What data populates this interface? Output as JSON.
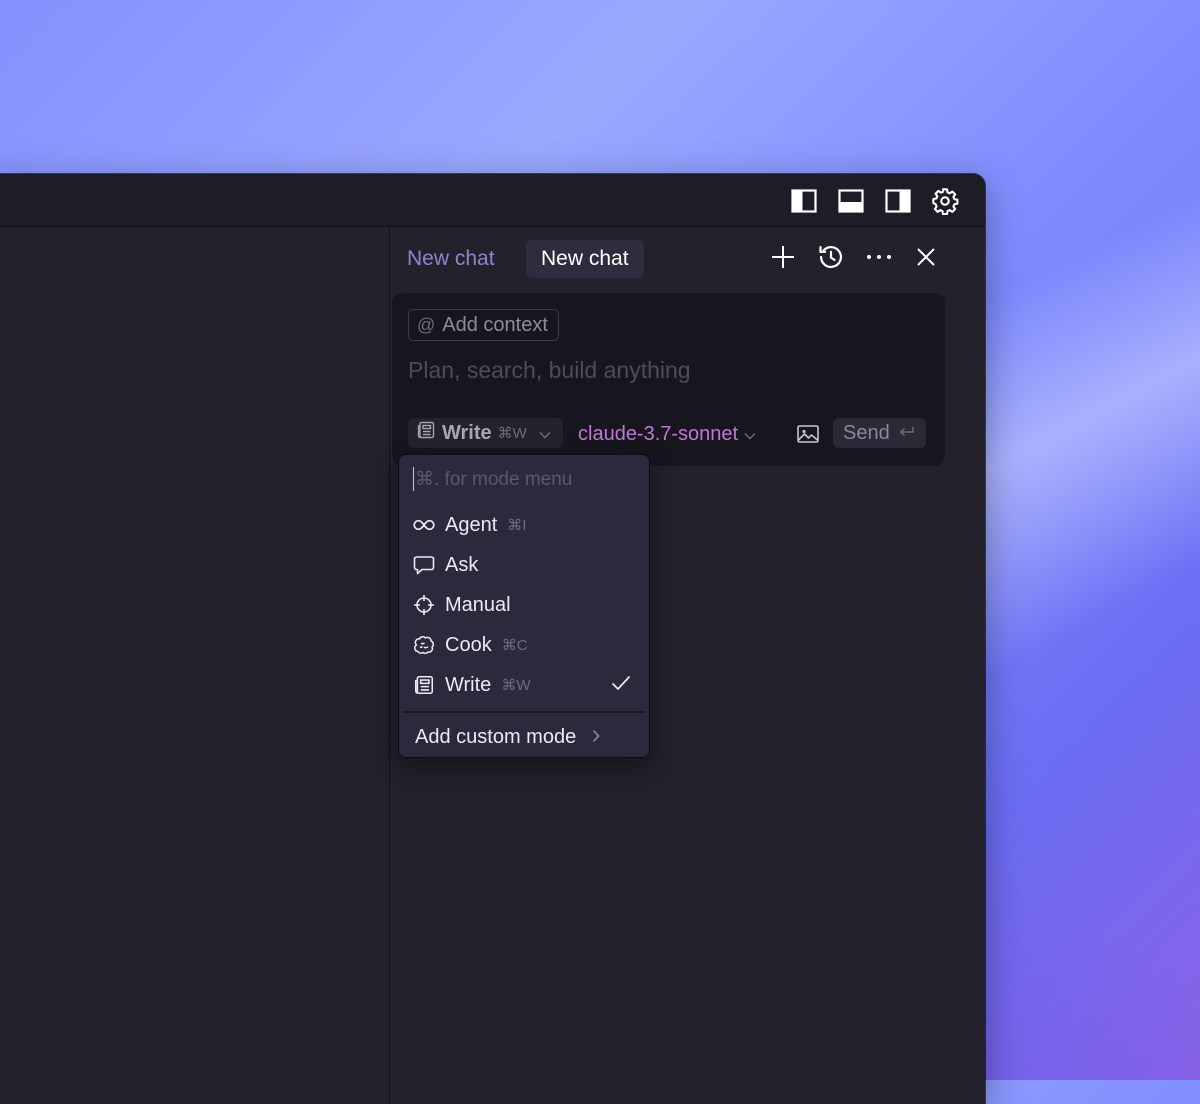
{
  "titlebar": {
    "icons": [
      "toggle-left-sidebar-icon",
      "toggle-bottom-panel-icon",
      "toggle-right-sidebar-icon",
      "gear-icon"
    ]
  },
  "chat": {
    "tabs": [
      {
        "label": "New chat",
        "active": false
      },
      {
        "label": "New chat",
        "active": true
      }
    ],
    "header_icons": [
      "plus-icon",
      "history-icon",
      "more-icon",
      "close-icon"
    ]
  },
  "composer": {
    "add_context_label": "Add context",
    "placeholder": "Plan, search, build anything",
    "mode_label": "Write",
    "mode_shortcut": "⌘W",
    "model_label": "claude-3.7-sonnet",
    "send_label": "Send"
  },
  "mode_menu": {
    "search_placeholder": "⌘. for mode menu",
    "items": [
      {
        "label": "Agent",
        "shortcut": "⌘I",
        "icon": "infinity-icon",
        "selected": false
      },
      {
        "label": "Ask",
        "shortcut": "",
        "icon": "chat-bubble-icon",
        "selected": false
      },
      {
        "label": "Manual",
        "shortcut": "",
        "icon": "crosshair-icon",
        "selected": false
      },
      {
        "label": "Cook",
        "shortcut": "⌘C",
        "icon": "brain-icon",
        "selected": false
      },
      {
        "label": "Write",
        "shortcut": "⌘W",
        "icon": "newspaper-icon",
        "selected": true
      }
    ],
    "add_custom_label": "Add custom mode"
  },
  "colors": {
    "window_bg": "#22212c",
    "composer_bg": "#17161f",
    "menu_bg": "#2b2a3d",
    "model_accent": "#c276d6",
    "inactive_tab": "#8d86cc"
  }
}
